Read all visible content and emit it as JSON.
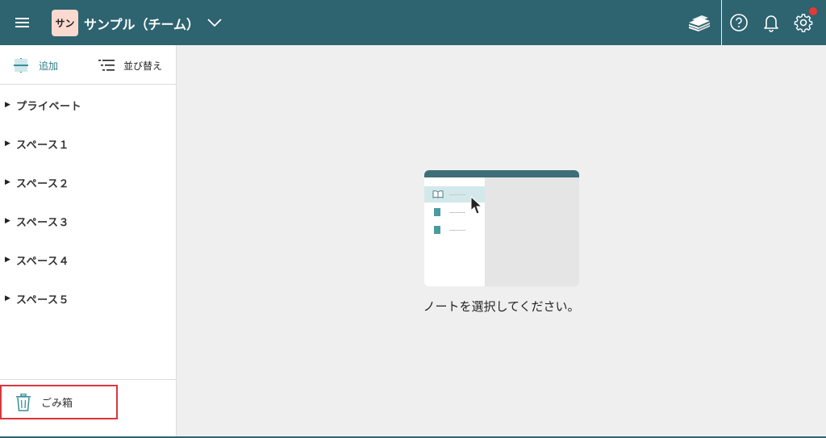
{
  "header": {
    "team_badge": "サン",
    "team_name": "サンプル（チーム）"
  },
  "sidebar": {
    "add_label": "追加",
    "sort_label": "並び替え",
    "items": [
      {
        "label": "プライベート"
      },
      {
        "label": "スペース１"
      },
      {
        "label": "スペース２"
      },
      {
        "label": "スペース３"
      },
      {
        "label": "スペース４"
      },
      {
        "label": "スペース５"
      }
    ],
    "trash_label": "ごみ箱"
  },
  "main": {
    "empty_message": "ノートを選択してください。"
  },
  "icons": {
    "menu": "hamburger-menu-icon",
    "chevron": "chevron-down-icon",
    "stack": "stack-icon",
    "help": "help-circle-icon",
    "bell": "bell-icon",
    "gear": "gear-icon",
    "add": "plus-icon",
    "sort": "sort-icon",
    "trash": "trash-icon"
  },
  "colors": {
    "header_bg": "#2e6370",
    "accent": "#3a8f9a",
    "notification": "#e53935",
    "highlight_border": "#d9363e"
  }
}
